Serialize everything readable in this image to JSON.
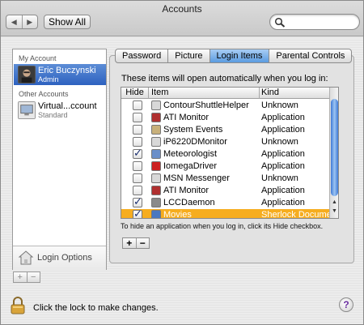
{
  "window": {
    "title": "Accounts"
  },
  "toolbar": {
    "back_icon": "◀",
    "forward_icon": "▶",
    "show_all_label": "Show All",
    "search_value": "",
    "search_placeholder": ""
  },
  "sidebar": {
    "my_account_header": "My Account",
    "current_user": {
      "name": "Eric Buczynski",
      "role": "Admin"
    },
    "other_accounts_header": "Other Accounts",
    "other_users": [
      {
        "name": "Virtual...ccount",
        "role": "Standard"
      }
    ],
    "login_options_label": "Login Options",
    "add_label": "+",
    "remove_label": "−"
  },
  "tabs": [
    {
      "label": "Password",
      "active": false
    },
    {
      "label": "Picture",
      "active": false
    },
    {
      "label": "Login Items",
      "active": true
    },
    {
      "label": "Parental Controls",
      "active": false
    }
  ],
  "login_items": {
    "intro": "These items will open automatically when you log in:",
    "columns": {
      "hide": "Hide",
      "item": "Item",
      "kind": "Kind"
    },
    "rows": [
      {
        "name": "ContourShuttleHelper",
        "kind": "Unknown",
        "hide": false,
        "icon": "doc-icon",
        "color": "#d8d8d8"
      },
      {
        "name": "ATI Monitor",
        "kind": "Application",
        "hide": false,
        "icon": "ati-icon",
        "color": "#b03030"
      },
      {
        "name": "System Events",
        "kind": "Application",
        "hide": false,
        "icon": "app-icon",
        "color": "#c8b07a"
      },
      {
        "name": "iP6220DMonitor",
        "kind": "Unknown",
        "hide": false,
        "icon": "doc-icon",
        "color": "#d8d8d8"
      },
      {
        "name": "Meteorologist",
        "kind": "Application",
        "hide": true,
        "icon": "weather-icon",
        "color": "#6b8fc9"
      },
      {
        "name": "IomegaDriver",
        "kind": "Application",
        "hide": false,
        "icon": "iomega-icon",
        "color": "#cc2020"
      },
      {
        "name": "MSN Messenger",
        "kind": "Unknown",
        "hide": false,
        "icon": "doc-icon",
        "color": "#d8d8d8"
      },
      {
        "name": "ATI Monitor",
        "kind": "Application",
        "hide": false,
        "icon": "ati-icon",
        "color": "#b03030"
      },
      {
        "name": "LCCDaemon",
        "kind": "Application",
        "hide": true,
        "icon": "lcc-icon",
        "color": "#8a8a8a"
      },
      {
        "name": "Movies",
        "kind": "Sherlock Docume",
        "hide": true,
        "icon": "sherlock-icon",
        "color": "#4a78c0",
        "selected": true
      }
    ],
    "hint": "To hide an application when you log in, click its Hide checkbox.",
    "add_label": "+",
    "remove_label": "−"
  },
  "footer": {
    "lock_text": "Click the lock to make changes.",
    "help_label": "?"
  },
  "colors": {
    "selection": "#f6ad1f",
    "active_tab": "#5b9be0",
    "sidebar_selection": "#2e62c0"
  }
}
